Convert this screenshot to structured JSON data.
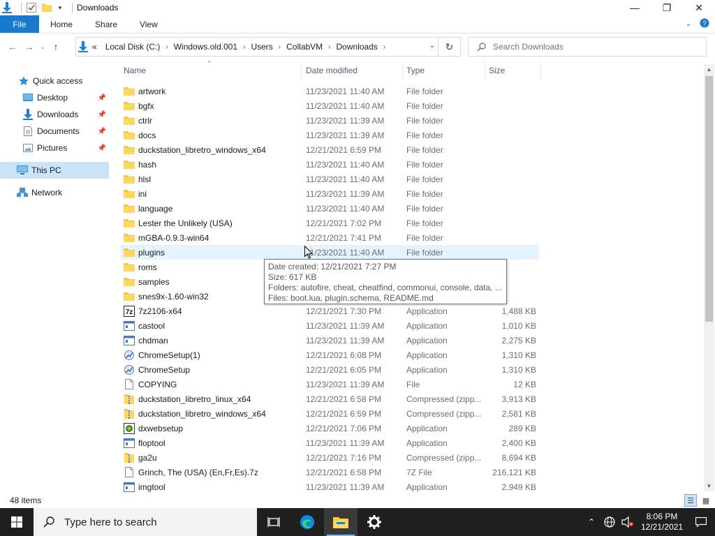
{
  "window": {
    "title": "Downloads"
  },
  "ribbon": {
    "tabs": [
      "File",
      "Home",
      "Share",
      "View"
    ]
  },
  "address": {
    "overflow": "«",
    "crumbs": [
      "Local Disk (C:)",
      "Windows.old.001",
      "Users",
      "CollabVM",
      "Downloads"
    ]
  },
  "search": {
    "placeholder": "Search Downloads"
  },
  "navpane": {
    "quick_access": "Quick access",
    "desktop": "Desktop",
    "downloads": "Downloads",
    "documents": "Documents",
    "pictures": "Pictures",
    "this_pc": "This PC",
    "network": "Network"
  },
  "columns": {
    "name": "Name",
    "date": "Date modified",
    "type": "Type",
    "size": "Size"
  },
  "files": [
    {
      "name": "artwork",
      "date": "11/23/2021 11:40 AM",
      "type": "File folder",
      "size": "",
      "icon": "folder"
    },
    {
      "name": "bgfx",
      "date": "11/23/2021 11:40 AM",
      "type": "File folder",
      "size": "",
      "icon": "folder"
    },
    {
      "name": "ctrlr",
      "date": "11/23/2021 11:39 AM",
      "type": "File folder",
      "size": "",
      "icon": "folder"
    },
    {
      "name": "docs",
      "date": "11/23/2021 11:39 AM",
      "type": "File folder",
      "size": "",
      "icon": "folder"
    },
    {
      "name": "duckstation_libretro_windows_x64",
      "date": "12/21/2021 6:59 PM",
      "type": "File folder",
      "size": "",
      "icon": "folder"
    },
    {
      "name": "hash",
      "date": "11/23/2021 11:40 AM",
      "type": "File folder",
      "size": "",
      "icon": "folder"
    },
    {
      "name": "hlsl",
      "date": "11/23/2021 11:40 AM",
      "type": "File folder",
      "size": "",
      "icon": "folder"
    },
    {
      "name": "ini",
      "date": "11/23/2021 11:39 AM",
      "type": "File folder",
      "size": "",
      "icon": "folder"
    },
    {
      "name": "language",
      "date": "11/23/2021 11:40 AM",
      "type": "File folder",
      "size": "",
      "icon": "folder"
    },
    {
      "name": "Lester the Unlikely (USA)",
      "date": "12/21/2021 7:02 PM",
      "type": "File folder",
      "size": "",
      "icon": "folder"
    },
    {
      "name": "mGBA-0.9.3-win64",
      "date": "12/21/2021 7:41 PM",
      "type": "File folder",
      "size": "",
      "icon": "folder"
    },
    {
      "name": "plugins",
      "date": "11/23/2021 11:40 AM",
      "type": "File folder",
      "size": "",
      "icon": "folder"
    },
    {
      "name": "roms",
      "date": "",
      "type": "",
      "size": "",
      "icon": "folder"
    },
    {
      "name": "samples",
      "date": "",
      "type": "",
      "size": "",
      "icon": "folder"
    },
    {
      "name": "snes9x-1.60-win32",
      "date": "",
      "type": "",
      "size": "",
      "icon": "folder"
    },
    {
      "name": "7z2106-x64",
      "date": "12/21/2021 7:30 PM",
      "type": "Application",
      "size": "1,488 KB",
      "icon": "7z"
    },
    {
      "name": "castool",
      "date": "11/23/2021 11:39 AM",
      "type": "Application",
      "size": "1,010 KB",
      "icon": "app"
    },
    {
      "name": "chdman",
      "date": "11/23/2021 11:39 AM",
      "type": "Application",
      "size": "2,275 KB",
      "icon": "app"
    },
    {
      "name": "ChromeSetup(1)",
      "date": "12/21/2021 6:08 PM",
      "type": "Application",
      "size": "1,310 KB",
      "icon": "setup"
    },
    {
      "name": "ChromeSetup",
      "date": "12/21/2021 6:05 PM",
      "type": "Application",
      "size": "1,310 KB",
      "icon": "setup"
    },
    {
      "name": "COPYING",
      "date": "11/23/2021 11:39 AM",
      "type": "File",
      "size": "12 KB",
      "icon": "file"
    },
    {
      "name": "duckstation_libretro_linux_x64",
      "date": "12/21/2021 6:58 PM",
      "type": "Compressed (zipp...",
      "size": "3,913 KB",
      "icon": "zip"
    },
    {
      "name": "duckstation_libretro_windows_x64",
      "date": "12/21/2021 6:59 PM",
      "type": "Compressed (zipp...",
      "size": "2,581 KB",
      "icon": "zip"
    },
    {
      "name": "dxwebsetup",
      "date": "12/21/2021 7:06 PM",
      "type": "Application",
      "size": "289 KB",
      "icon": "dx"
    },
    {
      "name": "floptool",
      "date": "11/23/2021 11:39 AM",
      "type": "Application",
      "size": "2,400 KB",
      "icon": "app"
    },
    {
      "name": "ga2u",
      "date": "12/21/2021 7:16 PM",
      "type": "Compressed (zipp...",
      "size": "8,694 KB",
      "icon": "zip"
    },
    {
      "name": "Grinch, The (USA) (En,Fr,Es).7z",
      "date": "12/21/2021 6:58 PM",
      "type": "7Z File",
      "size": "216,121 KB",
      "icon": "file"
    },
    {
      "name": "imgtool",
      "date": "11/23/2021 11:39 AM",
      "type": "Application",
      "size": "2,949 KB",
      "icon": "app"
    }
  ],
  "hover_row": 11,
  "tooltip": {
    "line1": "Date created: 12/21/2021 7:27 PM",
    "line2": "Size: 617 KB",
    "line3": "Folders: autofire, cheat, cheatfind, commonui, console, data, ...",
    "line4": "Files: boot.lua, plugin.schema, README.md"
  },
  "status": {
    "items": "48 items"
  },
  "taskbar": {
    "search_placeholder": "Type here to search",
    "time": "8:06 PM",
    "date": "12/21/2021"
  },
  "colors": {
    "accent": "#1979ca",
    "selection": "#cce4f7",
    "hover": "#e5f3ff",
    "folder": "#ffd75e"
  }
}
